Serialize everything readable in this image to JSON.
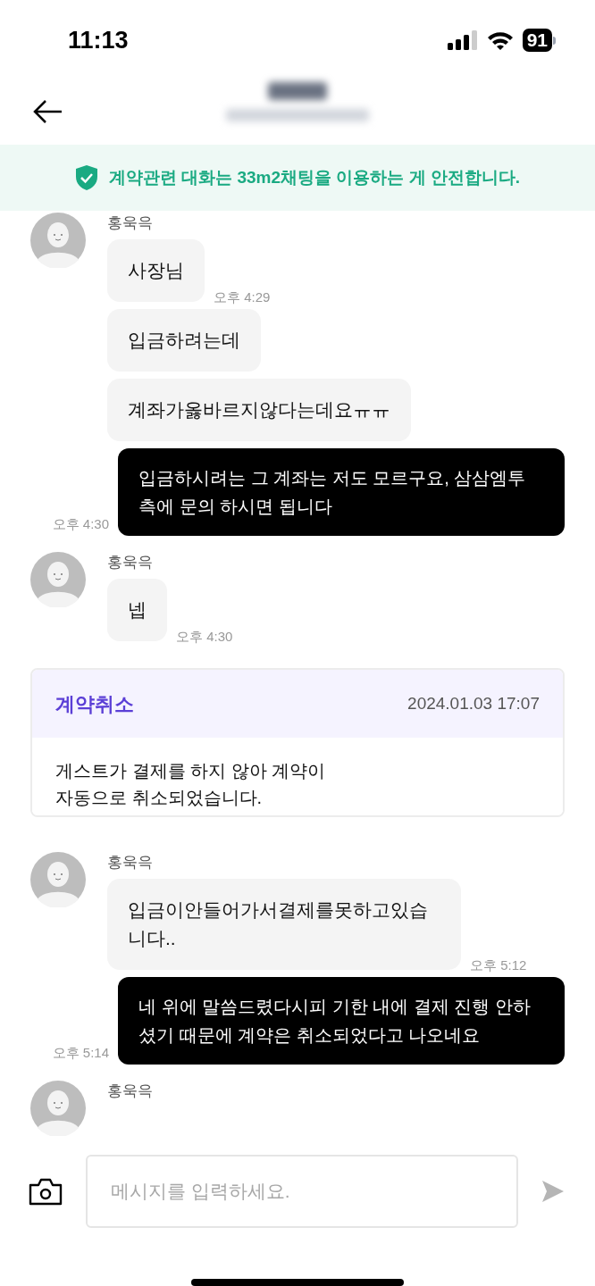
{
  "status_bar": {
    "time": "11:13",
    "battery": "91"
  },
  "banner": {
    "text": "계약관련 대화는 33m2채팅을 이용하는 게 안전합니다."
  },
  "messages": [
    {
      "kind": "received",
      "sender": "홍욱윽",
      "bubbles": [
        {
          "text": "사장님",
          "time": "오후 4:29"
        },
        {
          "text": "입금하려는데"
        },
        {
          "text": "계좌가옳바르지않다는데요ㅠㅠ"
        }
      ]
    },
    {
      "kind": "sent",
      "text": "입금하시려는 그 계좌는 저도 모르구요, 삼삼엠투 측에 문의 하시면 됩니다",
      "time": "오후 4:30"
    },
    {
      "kind": "received",
      "sender": "홍욱윽",
      "bubbles": [
        {
          "text": "넵",
          "time": "오후 4:30"
        }
      ]
    },
    {
      "kind": "notice",
      "title": "계약취소",
      "date": "2024.01.03 17:07",
      "body": "게스트가 결제를 하지 않아 계약이\n자동으로 취소되었습니다."
    },
    {
      "kind": "received",
      "sender": "홍욱윽",
      "bubbles": [
        {
          "text": "입금이안들어가서결제를못하고있습니다..",
          "time": "오후 5:12"
        }
      ]
    },
    {
      "kind": "sent",
      "text": "네 위에 말씀드렸다시피 기한 내에 결제 진행 안하셨기 때문에 계약은 취소되었다고 나오네요",
      "time": "오후 5:14"
    },
    {
      "kind": "received",
      "sender": "홍욱윽"
    }
  ],
  "composer": {
    "placeholder": "메시지를 입력하세요."
  }
}
